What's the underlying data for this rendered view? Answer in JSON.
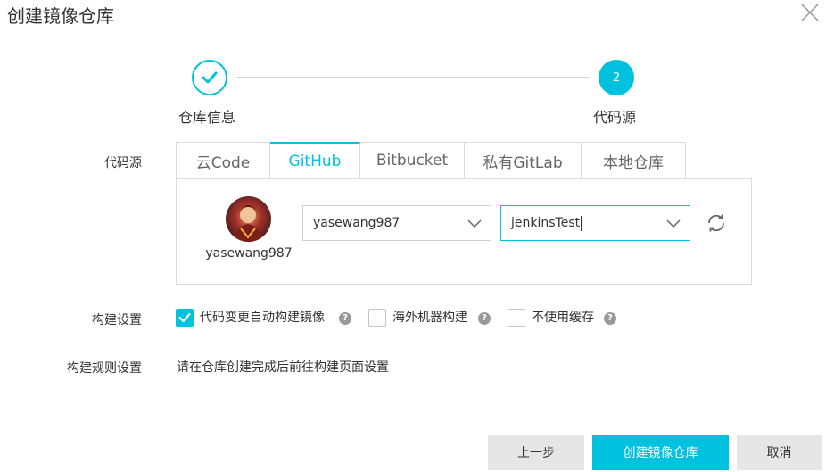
{
  "dialog": {
    "title": "创建镜像仓库"
  },
  "stepper": {
    "steps": [
      {
        "label": "仓库信息",
        "state": "done"
      },
      {
        "label": "代码源",
        "number": "2",
        "state": "current"
      }
    ]
  },
  "code_source": {
    "label": "代码源",
    "tabs": [
      {
        "label": "云Code",
        "active": false
      },
      {
        "label": "GitHub",
        "active": true
      },
      {
        "label": "Bitbucket",
        "active": false
      },
      {
        "label": "私有GitLab",
        "active": false
      },
      {
        "label": "本地仓库",
        "active": false
      }
    ],
    "account": {
      "username": "yasewang987"
    },
    "namespace_select": {
      "value": "yasewang987"
    },
    "repo_select": {
      "value": "jenkinsTest"
    }
  },
  "build_settings": {
    "label": "构建设置",
    "options": [
      {
        "label": "代码变更自动构建镜像",
        "checked": true
      },
      {
        "label": "海外机器构建",
        "checked": false
      },
      {
        "label": "不使用缓存",
        "checked": false
      }
    ],
    "help_glyph": "?"
  },
  "build_rules": {
    "label": "构建规则设置",
    "hint": "请在仓库创建完成后前往构建页面设置"
  },
  "footer": {
    "prev_label": "上一步",
    "create_label": "创建镜像仓库",
    "cancel_label": "取消"
  },
  "colors": {
    "accent": "#00c1de",
    "button_gray": "#e6e6e6",
    "border": "#dcdcdc",
    "help_gray": "#999999"
  },
  "icons": {
    "close": "close-icon",
    "step_done": "check-icon",
    "dropdown": "chevron-down-icon",
    "refresh": "refresh-icon",
    "checkbox_checked": "check-icon",
    "help": "question-circle-icon"
  }
}
